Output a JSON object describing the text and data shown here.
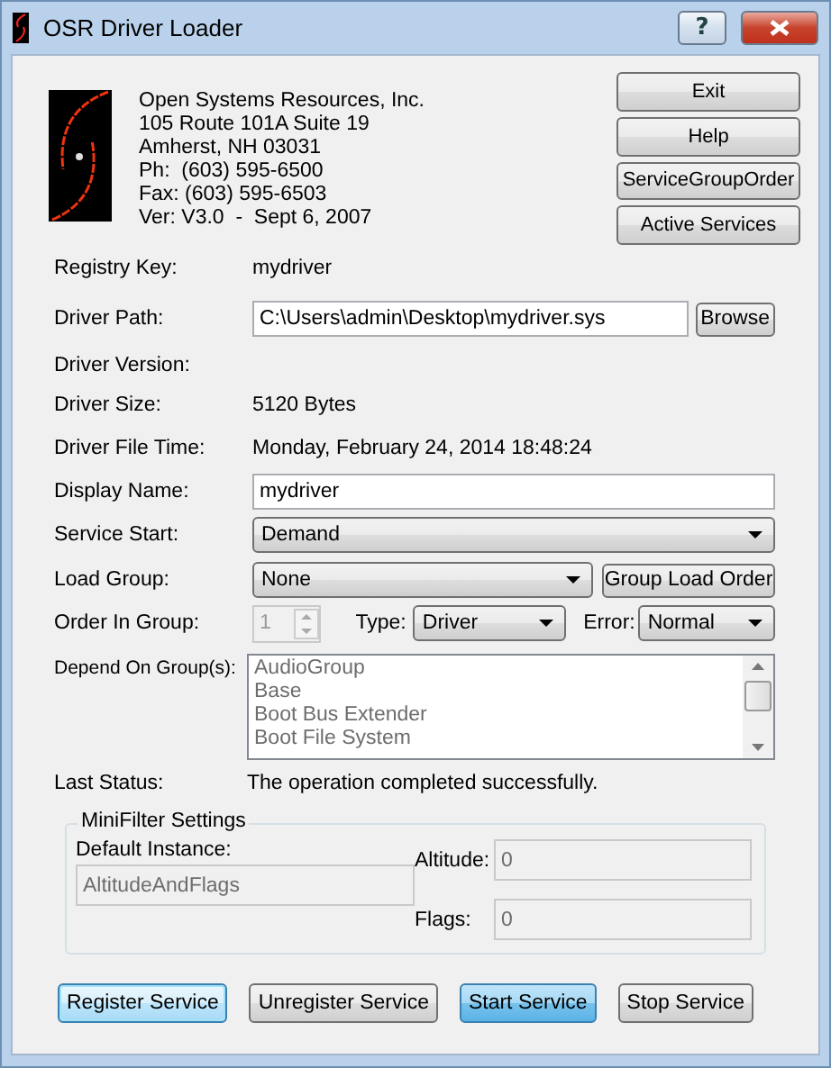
{
  "window": {
    "title": "OSR Driver Loader",
    "help_label": "?"
  },
  "company": [
    "Open Systems Resources, Inc.",
    "105 Route 101A Suite 19",
    "Amherst, NH 03031",
    "Ph:  (603) 595-6500",
    "Fax: (603) 595-6503",
    "Ver: V3.0  -  Sept 6, 2007"
  ],
  "side_buttons": [
    "Exit",
    "Help",
    "ServiceGroupOrder",
    "Active Services"
  ],
  "registry_key": {
    "label": "Registry Key:",
    "value": "mydriver"
  },
  "driver_path": {
    "label": "Driver Path:",
    "value": "C:\\Users\\admin\\Desktop\\mydriver.sys",
    "button": "Browse"
  },
  "driver_version": {
    "label": "Driver Version:"
  },
  "driver_size": {
    "label": "Driver Size:",
    "value": "5120 Bytes"
  },
  "driver_file_time": {
    "label": "Driver File Time:",
    "value": "Monday, February 24, 2014 18:48:24"
  },
  "display_name": {
    "label": "Display Name:",
    "value": "mydriver"
  },
  "service_start": {
    "label": "Service Start:",
    "value": "Demand"
  },
  "load_group": {
    "label": "Load Group:",
    "value": "None",
    "button": "Group Load Order"
  },
  "order_in_group": {
    "label": "Order In Group:",
    "value": "1",
    "disabled": true
  },
  "type": {
    "label": "Type:",
    "value": "Driver"
  },
  "error": {
    "label": "Error:",
    "value": "Normal"
  },
  "depend_on_groups": {
    "label": "Depend On Group(s):",
    "disabled": true,
    "items": [
      "AudioGroup",
      "Base",
      "Boot Bus Extender",
      "Boot File System"
    ]
  },
  "last_status": {
    "label": "Last Status:",
    "value": "The operation completed successfully."
  },
  "minifilter": {
    "title": "MiniFilter Settings",
    "default_instance": {
      "label": "Default Instance:",
      "value": "AltitudeAndFlags",
      "disabled": true
    },
    "altitude": {
      "label": "Altitude:",
      "value": "0",
      "disabled": true
    },
    "flags": {
      "label": "Flags:",
      "value": "0",
      "disabled": true
    }
  },
  "action_buttons": [
    {
      "label": "Register Service",
      "focused": true,
      "hot": false
    },
    {
      "label": "Unregister Service",
      "focused": false,
      "hot": false
    },
    {
      "label": "Start Service",
      "focused": false,
      "hot": true
    },
    {
      "label": "Stop Service",
      "focused": false,
      "hot": false
    }
  ]
}
